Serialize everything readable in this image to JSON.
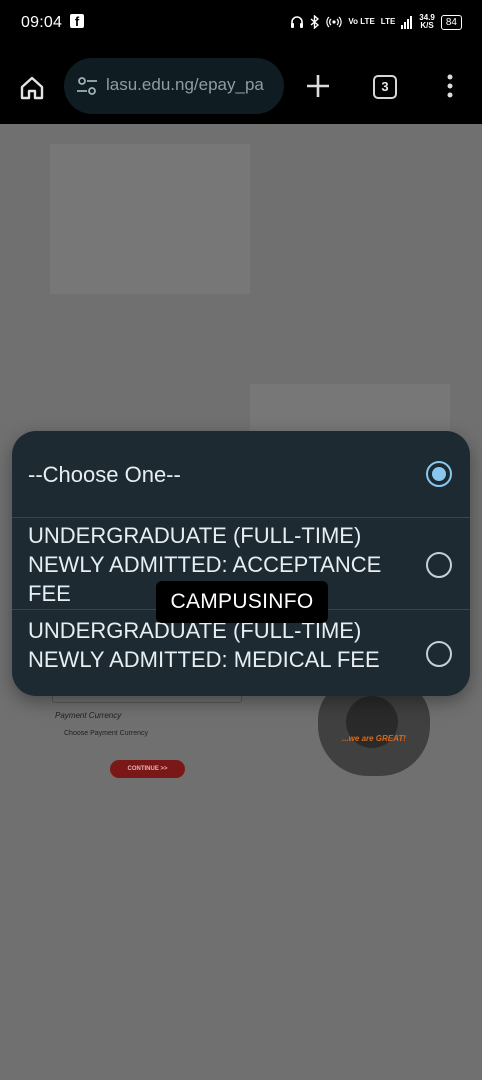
{
  "status_bar": {
    "time": "09:04",
    "app_icon": "facebook-icon",
    "network_label_1": "Vo LTE",
    "network_label_2": "LTE",
    "speed": "34.9",
    "speed_unit": "K/S",
    "battery": "84"
  },
  "browser": {
    "url": "lasu.edu.ng/epay_pa",
    "tab_count": "3"
  },
  "background_page": {
    "payment_currency_label": "Payment Currency",
    "currency_option": "Choose Payment Currency",
    "continue_label": "CONTINUE >>",
    "slogan": "...we are GREAT!"
  },
  "dialog": {
    "options": [
      {
        "label": "--Choose One--",
        "selected": true
      },
      {
        "label": "UNDERGRADUATE (FULL-TIME) NEWLY ADMITTED: ACCEPTANCE FEE",
        "selected": false
      },
      {
        "label": "UNDERGRADUATE (FULL-TIME) NEWLY ADMITTED: MEDICAL FEE",
        "selected": false
      }
    ]
  },
  "watermark": "CAMPUSINFO",
  "colors": {
    "dialog_bg": "#1d2a31",
    "radio_selected": "#88c8ef",
    "scrim": "#707070"
  }
}
